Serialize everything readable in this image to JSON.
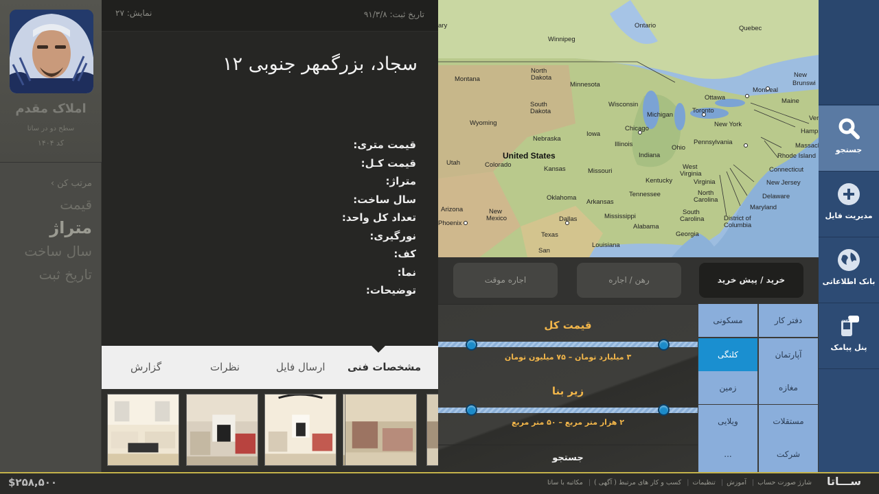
{
  "profile": {
    "agency_name": "املاک مقدم",
    "level": "سطح دو در ساتا",
    "code": "کد ۱۴۰۴"
  },
  "sort": {
    "heading": "مرتب کن ›",
    "items": [
      {
        "label": "قیمت",
        "active": false
      },
      {
        "label": "متراژ",
        "active": true
      },
      {
        "label": "سال ساخت",
        "active": false
      },
      {
        "label": "تاریخ ثبت",
        "active": false
      }
    ]
  },
  "property": {
    "reg_date": "تاریخ ثبت: ۹۱/۳/۸",
    "views": "نمایش: ۲۷",
    "title": "سجاد، بزرگمهر جنوبی ۱۲",
    "specs": [
      "قیمت متری:",
      "قیمت کـل:",
      "متراژ:",
      "سال ساخت:",
      "تعداد کل واحد:",
      "نورگیری:",
      "کف:",
      "نما:",
      "توضیحات:"
    ]
  },
  "tabs": [
    {
      "label": "مشخصات فنی",
      "active": true
    },
    {
      "label": "ارسال فایل",
      "active": false
    },
    {
      "label": "نظرات",
      "active": false
    },
    {
      "label": "گزارش",
      "active": false
    }
  ],
  "map": {
    "country": "United States",
    "labels": [
      "Ontario",
      "Quebec",
      "Winnipeg",
      "North Dakota",
      "Montana",
      "Minnesota",
      "South Dakota",
      "Wisconsin",
      "Michigan",
      "Ottawa",
      "Montreal",
      "Maine",
      "Toronto",
      "New York",
      "Wyoming",
      "Chicago",
      "Nebraska",
      "Iowa",
      "Illinois",
      "Ohio",
      "Pennsylvania",
      "Vermont",
      "New Hampshire",
      "Massachusetts",
      "Rhode Island",
      "Connecticut",
      "New Jersey",
      "Delaware",
      "Maryland",
      "District of Columbia",
      "Utah",
      "Colorado",
      "Kansas",
      "Missouri",
      "Indiana",
      "West Virginia",
      "Virginia",
      "Kentucky",
      "Oklahoma",
      "Arkansas",
      "Tennessee",
      "North Carolina",
      "South Carolina",
      "Georgia",
      "Alabama",
      "Mississippi",
      "Arizona",
      "Phoenix",
      "New Mexico",
      "Dallas",
      "Texas",
      "Louisiana",
      "San",
      "New Brunswick",
      "Maryland"
    ]
  },
  "deal_types": [
    {
      "label": "خرید / پیش خرید",
      "active": true
    },
    {
      "label": "رهن / اجاره",
      "active": false
    },
    {
      "label": "اجاره موقت",
      "active": false
    }
  ],
  "filters": {
    "price": {
      "label": "قیمت کل",
      "range_text": "۳ میلیارد تومان – ۷۵ میلیون تومان"
    },
    "area": {
      "label": "زیر بنا",
      "range_text": "۲ هزار متر مربع – ۵۰ متر مربع"
    },
    "search_label": "جستجو"
  },
  "property_types": [
    {
      "label": "مسکونی",
      "active": false
    },
    {
      "label": "دفتر کار",
      "active": false
    },
    {
      "label": "کلنگی",
      "active": true
    },
    {
      "label": "آپارتمان",
      "active": false
    },
    {
      "label": "زمین",
      "active": false
    },
    {
      "label": "مغازه",
      "active": false
    },
    {
      "label": "ویلایی",
      "active": false
    },
    {
      "label": "مستقلات",
      "active": false
    },
    {
      "label": "...",
      "active": false
    },
    {
      "label": "شرکت",
      "active": false
    }
  ],
  "nav": [
    {
      "label": "جستجو",
      "icon": "search-icon",
      "active": true
    },
    {
      "label": "مدیریت فایل",
      "icon": "plus-icon",
      "active": false
    },
    {
      "label": "بانک اطلاعاتی",
      "icon": "globe-icon",
      "active": false
    },
    {
      "label": "پنل پیامک",
      "icon": "sms-phone-icon",
      "active": false
    }
  ],
  "footer": {
    "balance": "$۲۵۸,۵۰۰",
    "links": [
      "شارژ صورت حساب",
      "آموزش",
      "تنظیمات",
      "کسب و کار های مرتبط ( آگهی )",
      "مکاتبه با ساتا"
    ],
    "brand": "ســـاتا"
  },
  "colors": {
    "accent_blue": "#1a8fd0",
    "filter_orange": "#f2b64a",
    "nav_blue": "#2d4b74",
    "footer_gold": "#c5b34a"
  }
}
